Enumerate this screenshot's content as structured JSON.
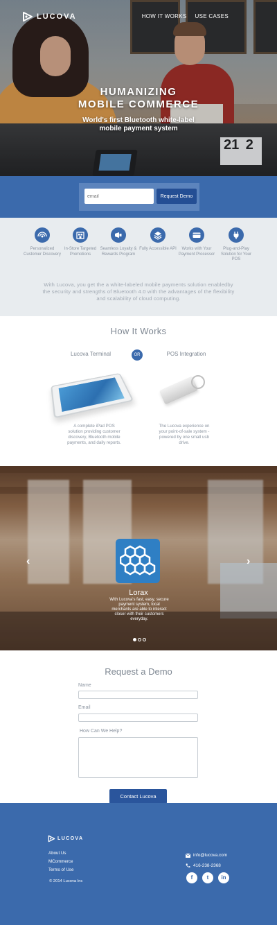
{
  "brand": {
    "name": "LUCOVA"
  },
  "nav": {
    "items": [
      "HOW IT WORKS",
      "USE CASES"
    ]
  },
  "hero": {
    "title_line1": "HUMANIZING",
    "title_line2": "MOBILE COMMERCE",
    "subtitle_line1": "World's first Bluetooth white-label",
    "subtitle_line2": "mobile payment system",
    "signs": [
      "21",
      "2"
    ]
  },
  "signup": {
    "placeholder": "email",
    "button": "Request Demo"
  },
  "features": {
    "items": [
      {
        "icon": "signal-icon",
        "label": "Personalized Customer Discovery"
      },
      {
        "icon": "store-icon",
        "label": "In-Store Targeted Promotions"
      },
      {
        "icon": "megaphone-icon",
        "label": "Seamless Loyalty & Rewards Program"
      },
      {
        "icon": "layers-icon",
        "label": "Fully Accessible API"
      },
      {
        "icon": "card-icon",
        "label": "Works with Your Payment Processor"
      },
      {
        "icon": "plug-icon",
        "label": "Plug-and-Play Solution for Your POS"
      }
    ],
    "description": "With Lucova, you get the a white-labeled mobile payments solution enabledby the security and strengths of Bluetooth 4.0 with the advantages of the flexibility and scalability of cloud computing."
  },
  "how": {
    "title": "How It Works",
    "left_title": "Lucova Terminal",
    "or": "OR",
    "right_title": "POS Integration",
    "left_desc": "A complete iPad POS solution providing customer discovery, Bluetooth mobile payments, and daily reports.",
    "right_desc": "The Lucova experience on your point-of-sale system - powered by one small usb drive."
  },
  "case_study": {
    "name": "Lorax",
    "description": "With Lucova's fast, easy, secure payment system, local merchants are able to interact closer with their customers everyday.",
    "slides_total": 3,
    "active_slide": 1
  },
  "demo_form": {
    "title": "Request a Demo",
    "name_label": "Name",
    "email_label": "Email",
    "help_label": "How Can We Help?",
    "button": "Contact Lucova"
  },
  "footer": {
    "brand": "LUCOVA",
    "links": [
      "About Us",
      "MCommerce",
      "Terms of Use"
    ],
    "copyright": "© 2014 Lucova Inc",
    "email": "info@lucova.com",
    "phone": "416-238-2368",
    "socials": [
      {
        "icon": "facebook-icon",
        "glyph": "f"
      },
      {
        "icon": "twitter-icon",
        "glyph": "t"
      },
      {
        "icon": "linkedin-icon",
        "glyph": "in"
      }
    ]
  },
  "colors": {
    "primary": "#3b6aac",
    "dark_button": "#244e94",
    "feature_bg": "#e8ecef"
  }
}
